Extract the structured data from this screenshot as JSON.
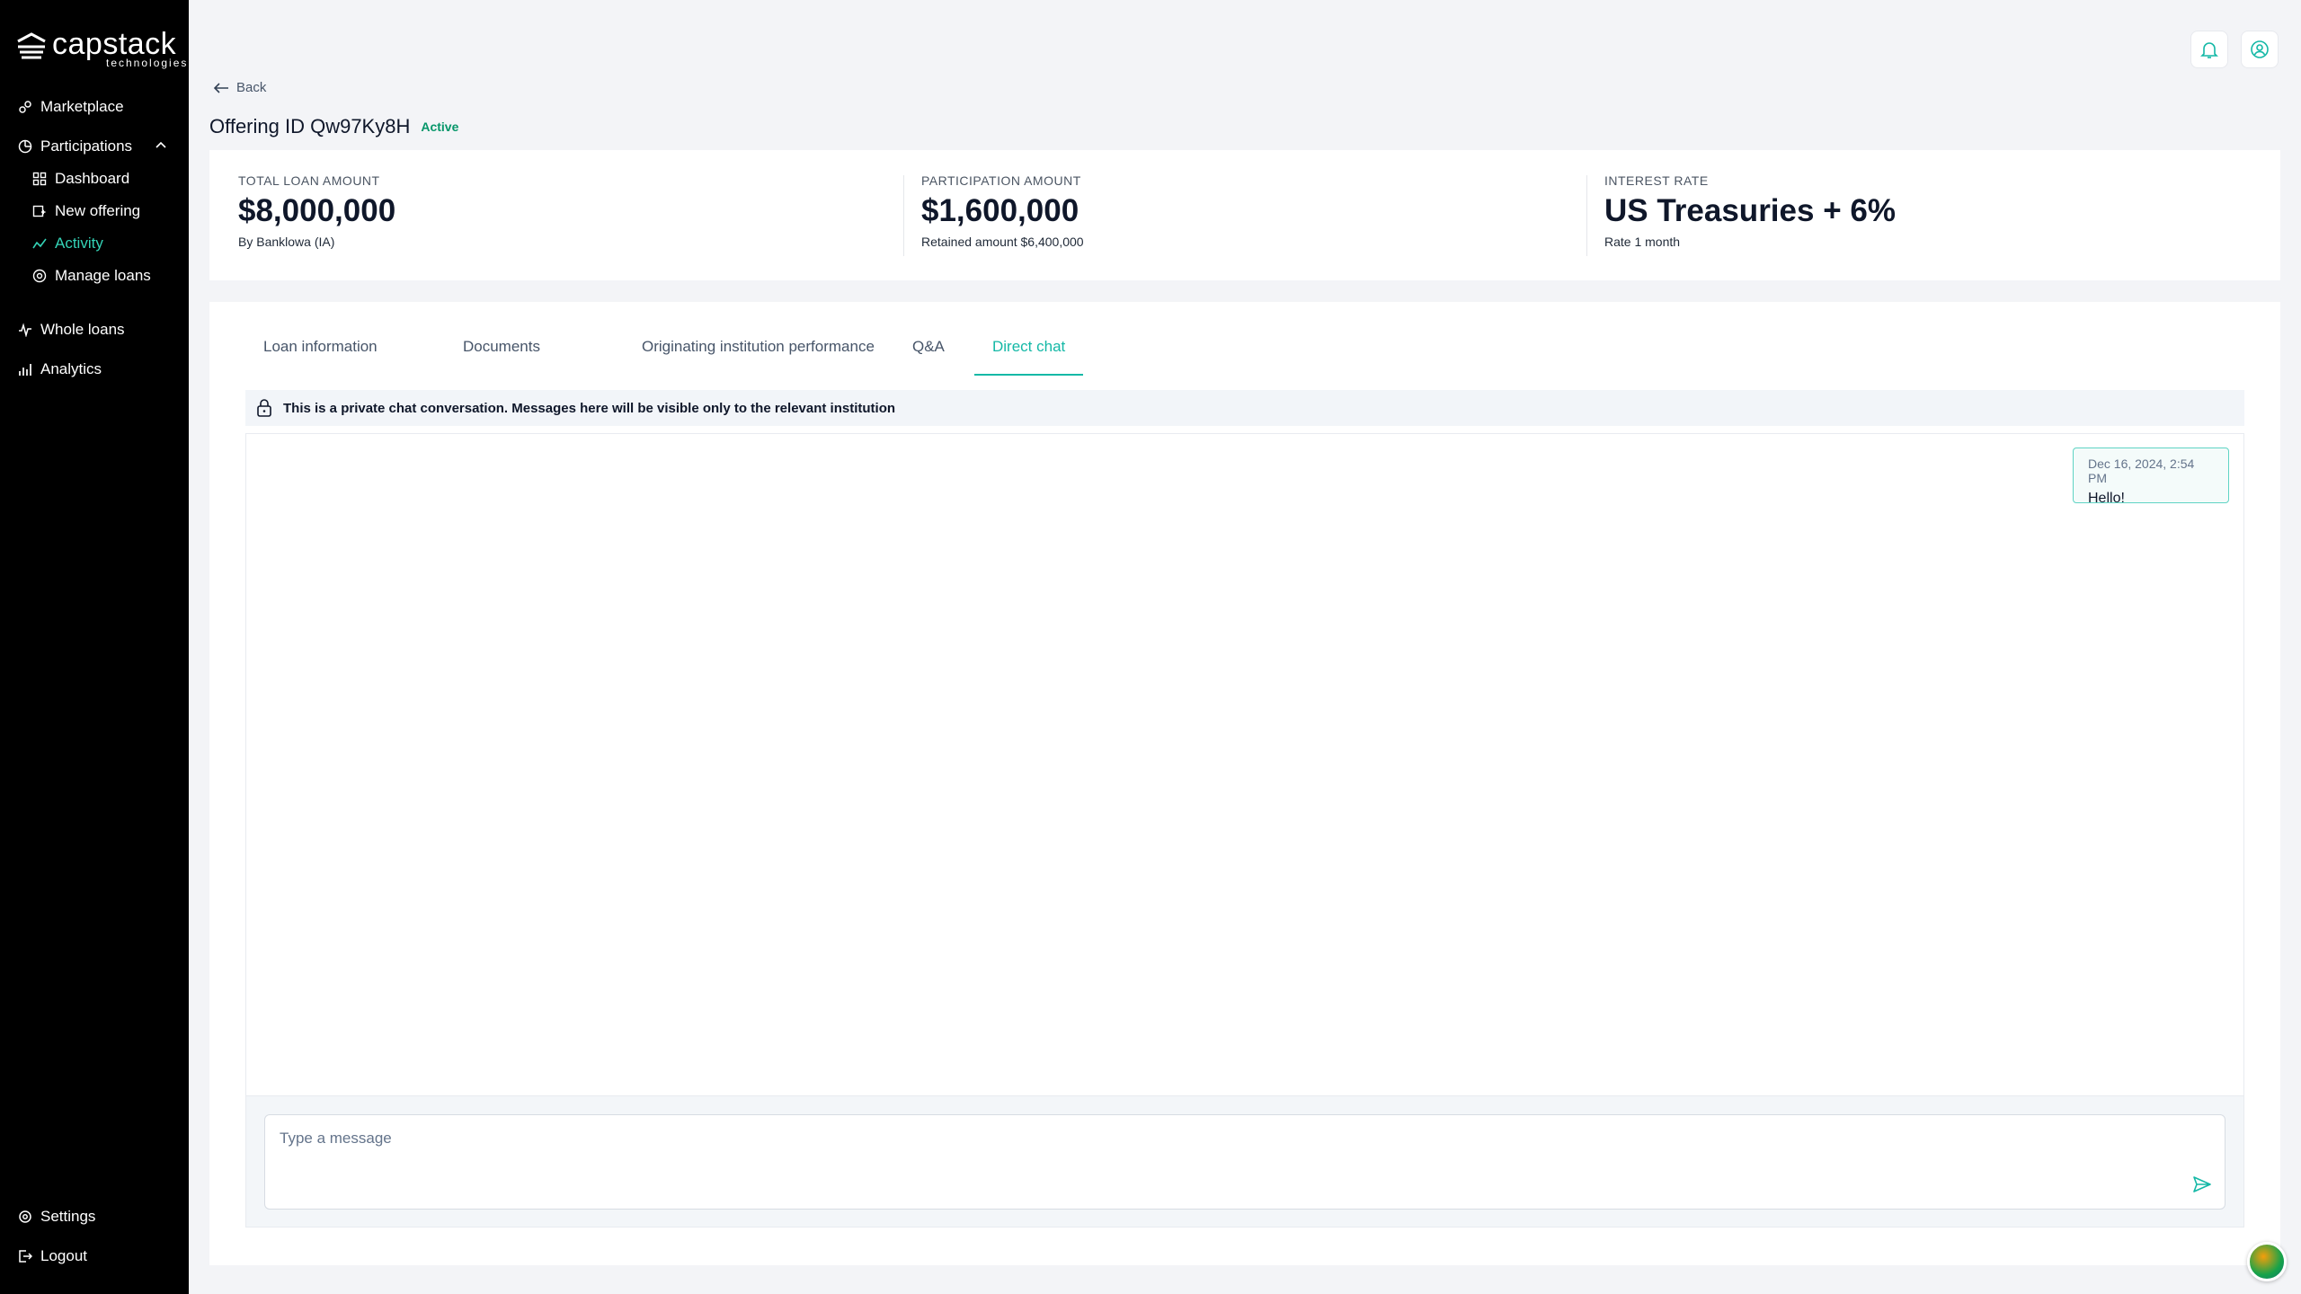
{
  "brand": {
    "name": "capstack",
    "sub": "technologies"
  },
  "sidebar": {
    "items": [
      {
        "label": "Marketplace",
        "icon": "marketplace-icon"
      },
      {
        "label": "Participations",
        "icon": "participations-icon"
      },
      {
        "label": "Dashboard",
        "icon": "dashboard-icon"
      },
      {
        "label": "New offering",
        "icon": "new-offering-icon"
      },
      {
        "label": "Activity",
        "icon": "activity-icon"
      },
      {
        "label": "Manage loans",
        "icon": "manage-loans-icon"
      },
      {
        "label": "Whole loans",
        "icon": "whole-loans-icon"
      },
      {
        "label": "Analytics",
        "icon": "analytics-icon"
      }
    ],
    "bottom": [
      {
        "label": "Settings",
        "icon": "gear-icon"
      },
      {
        "label": "Logout",
        "icon": "logout-icon"
      }
    ]
  },
  "header": {
    "back_label": "Back",
    "title": "Offering ID Qw97Ky8H",
    "status": "Active"
  },
  "summary": {
    "metrics": [
      {
        "label": "TOTAL LOAN AMOUNT",
        "value": "$8,000,000",
        "note": "By Banklowa (IA)"
      },
      {
        "label": "PARTICIPATION AMOUNT",
        "value": "$1,600,000",
        "note": "Retained amount $6,400,000"
      },
      {
        "label": "INTEREST RATE",
        "value": "US Treasuries + 6%",
        "note": "Rate 1 month"
      }
    ]
  },
  "tabs": [
    {
      "label": "Loan information"
    },
    {
      "label": "Documents"
    },
    {
      "label": "Originating institution performance"
    },
    {
      "label": "Q&A"
    },
    {
      "label": "Direct chat"
    }
  ],
  "chat": {
    "banner": "This is a private chat conversation. Messages here will be visible only to the relevant institution",
    "messages": [
      {
        "time": "Dec 16, 2024, 2:54 PM",
        "text": "Hello!"
      }
    ],
    "input_placeholder": "Type a message"
  },
  "colors": {
    "accent": "#14b8a6",
    "sidebar_bg": "#000000",
    "active_nav": "#34d3b6",
    "status": "#059669"
  }
}
